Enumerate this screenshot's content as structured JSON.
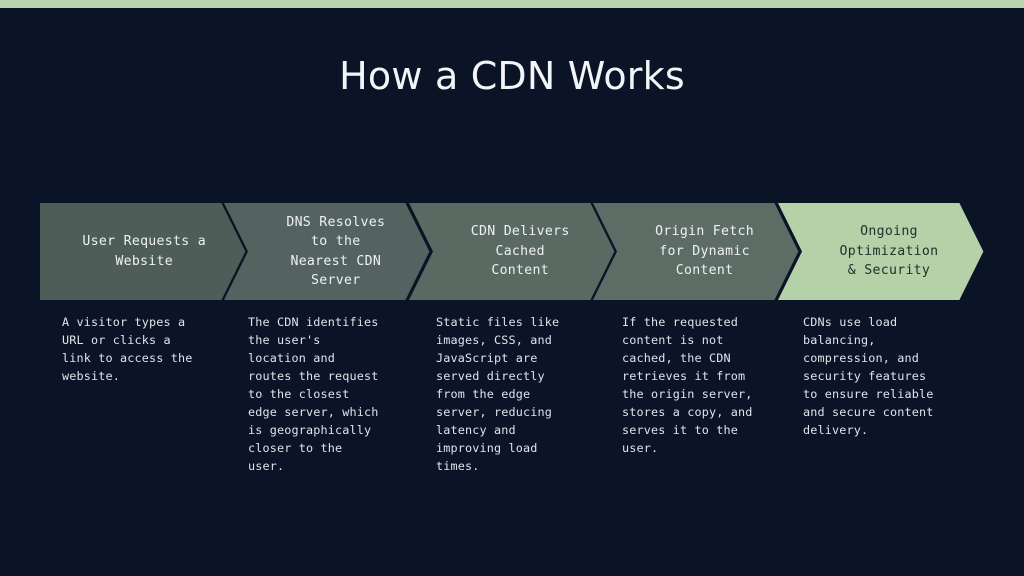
{
  "slide": {
    "title": "How a CDN Works",
    "background_color": "#0b1326",
    "accent_bar_color": "#b8d3ae",
    "title_color": "#f2f5f8"
  },
  "flow": {
    "steps": [
      {
        "label": "User Requests a\nWebsite",
        "description": "A visitor types a\nURL or clicks a\nlink to access the\nwebsite.",
        "fill_color": "#4e5d57",
        "label_color": "#eef1f3"
      },
      {
        "label": "DNS Resolves\nto the\nNearest CDN\nServer",
        "description": "The CDN identifies\nthe user's\nlocation and\nroutes the request\nto the closest\nedge server, which\nis geographically\ncloser to the\nuser.",
        "fill_color": "#556360",
        "label_color": "#eef1f3"
      },
      {
        "label": "CDN Delivers\nCached\nContent",
        "description": "Static files like\nimages, CSS, and\nJavaScript are\nserved directly\nfrom the edge\nserver, reducing\nlatency and\nimproving load\ntimes.",
        "fill_color": "#5a6a62",
        "label_color": "#eef1f3"
      },
      {
        "label": "Origin Fetch\nfor Dynamic\nContent",
        "description": "If the requested\ncontent is not\ncached, the CDN\nretrieves it from\nthe origin server,\nstores a copy, and\nserves it to the\nuser.",
        "fill_color": "#5d6c64",
        "label_color": "#eef1f3"
      },
      {
        "label": "Ongoing\nOptimization\n& Security",
        "description": "CDNs use load\nbalancing,\ncompression, and\nsecurity features\nto ensure reliable\nand secure content\ndelivery.",
        "fill_color": "#b4d1a8",
        "label_color": "#22302b"
      }
    ]
  }
}
